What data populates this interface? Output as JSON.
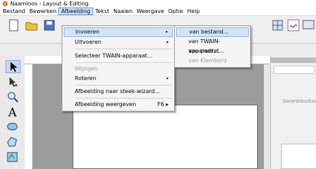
{
  "window": {
    "title": "Naamloos - Layout & Editing"
  },
  "menubar": {
    "items": [
      "Bestand",
      "Bewerken",
      "Afbeelding",
      "Tekst",
      "Naaien",
      "Weergave",
      "Optie",
      "Help"
    ],
    "active_index": 2
  },
  "menu": {
    "items": [
      {
        "label": "Invoeren",
        "submenu_arrow": "▸",
        "highlighted": true
      },
      {
        "label": "Uitvoeren",
        "submenu_arrow": "▸"
      },
      {
        "label": "Selecteer TWAIN-apparaat..."
      },
      {
        "label": "Wijzigen",
        "disabled": true
      },
      {
        "label": "Roteren",
        "submenu_arrow": "▸"
      },
      {
        "label": "Afbeelding naar steek-wizard..."
      },
      {
        "label": "Afbeelding weergeven",
        "shortcut": "F6 ▸"
      }
    ]
  },
  "submenu": {
    "items": [
      {
        "label": "van bestand...",
        "highlighted": true
      },
      {
        "label": "van TWAIN-apparaat..."
      },
      {
        "label": "van portret..."
      },
      {
        "label": "van Klembord",
        "disabled": true
      }
    ]
  },
  "ruler": {
    "v_mark": "50"
  },
  "right_panel": {
    "label": "Garenkleurkaart"
  },
  "colors": {
    "accent": "#d3e3f8",
    "accent_border": "#8fb2e4",
    "workspace": "#9c9c9c"
  }
}
